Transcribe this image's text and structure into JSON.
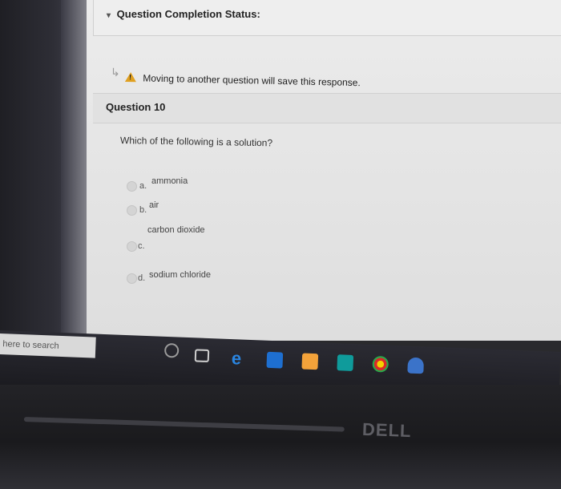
{
  "status": {
    "title": "Question Completion Status:"
  },
  "warning": {
    "text": "Moving to another question will save this response."
  },
  "question": {
    "title": "Question 10",
    "text": "Which of the following is a solution?",
    "options": [
      {
        "letter": "a.",
        "label": "ammonia"
      },
      {
        "letter": "b.",
        "label": "air"
      },
      {
        "letter": "c.",
        "label": "carbon dioxide"
      },
      {
        "letter": "d.",
        "label": "sodium chloride"
      }
    ]
  },
  "taskbar": {
    "search_placeholder": "here to search"
  },
  "brand": {
    "logo_text": "DELL"
  },
  "colors": {
    "warning": "#e0a020",
    "edge_blue": "#1e6fd0",
    "store_orange": "#f3a23a",
    "teal": "#0f9b9b"
  }
}
